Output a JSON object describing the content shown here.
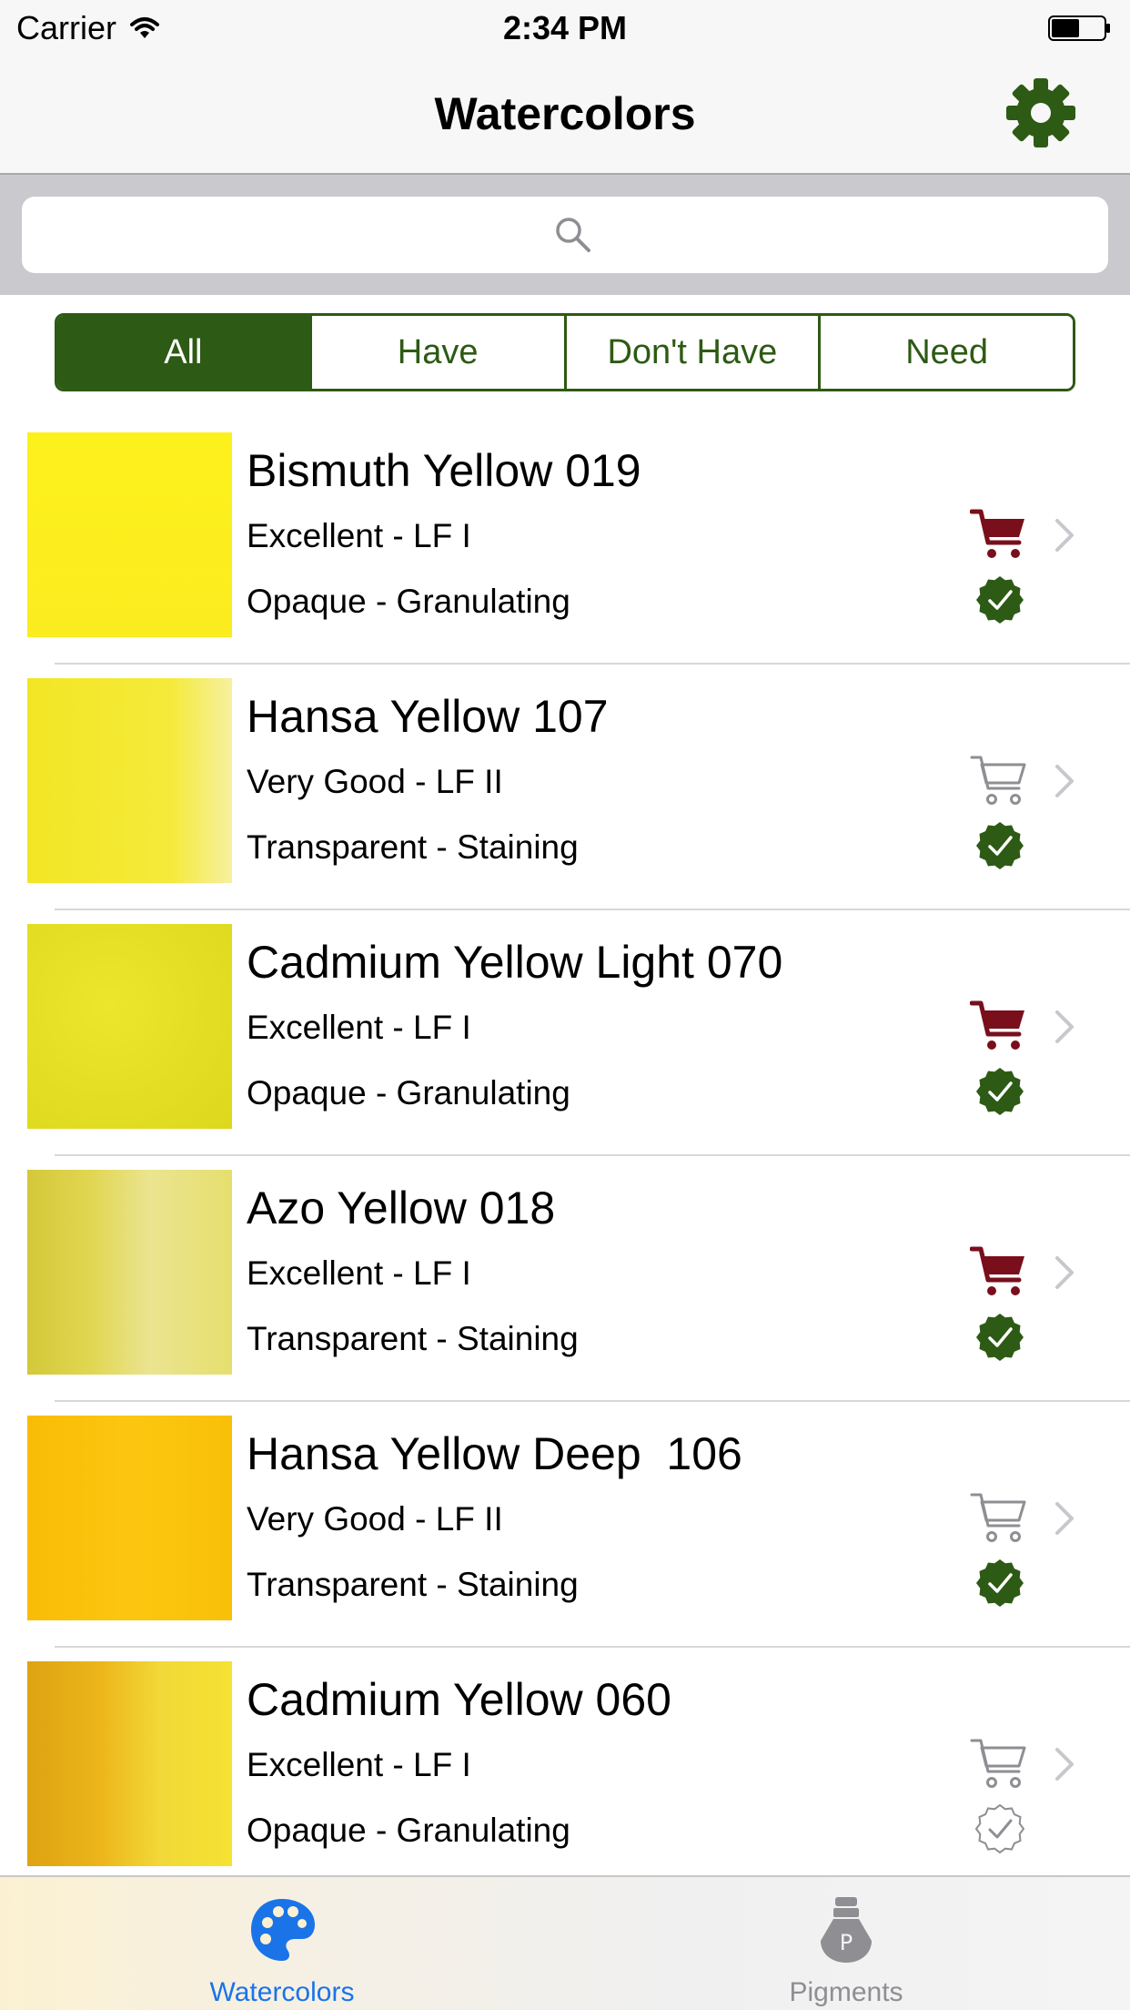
{
  "status_bar": {
    "carrier": "Carrier",
    "time": "2:34 PM"
  },
  "nav": {
    "title": "Watercolors",
    "settings_icon": "gear-icon"
  },
  "search": {
    "placeholder": "",
    "icon": "search-icon"
  },
  "segments": [
    "All",
    "Have",
    "Don't Have",
    "Need"
  ],
  "selected_segment": "All",
  "colors": {
    "accent_green": "#2d5a14",
    "cart_red": "#7a0f1c",
    "tab_blue": "#1a74e8"
  },
  "paints": [
    {
      "name": "Bismuth Yellow 019",
      "quality": "Excellent - LF I",
      "properties": "Opaque - Granulating",
      "need": true,
      "have": true,
      "swatch": "#fcef1e"
    },
    {
      "name": "Hansa Yellow 107",
      "quality": "Very Good - LF II",
      "properties": "Transparent - Staining",
      "need": false,
      "have": true,
      "swatch": "#f4e92e"
    },
    {
      "name": "Cadmium Yellow Light 070",
      "quality": "Excellent - LF I",
      "properties": "Opaque - Granulating",
      "need": true,
      "have": true,
      "swatch": "#e8e326"
    },
    {
      "name": "Azo Yellow 018",
      "quality": "Excellent - LF I",
      "properties": "Transparent - Staining",
      "need": true,
      "have": true,
      "swatch": "#e4dc60"
    },
    {
      "name": "Hansa Yellow Deep  106",
      "quality": "Very Good - LF II",
      "properties": "Transparent - Staining",
      "need": false,
      "have": true,
      "swatch": "#fbc20a"
    },
    {
      "name": "Cadmium Yellow 060",
      "quality": "Excellent - LF I",
      "properties": "Opaque - Granulating",
      "need": false,
      "have": false,
      "swatch": "#f0c622"
    }
  ],
  "tabs": [
    {
      "label": "Watercolors",
      "icon": "palette-icon",
      "selected": true
    },
    {
      "label": "Pigments",
      "icon": "lightbulb-icon",
      "selected": false
    }
  ]
}
